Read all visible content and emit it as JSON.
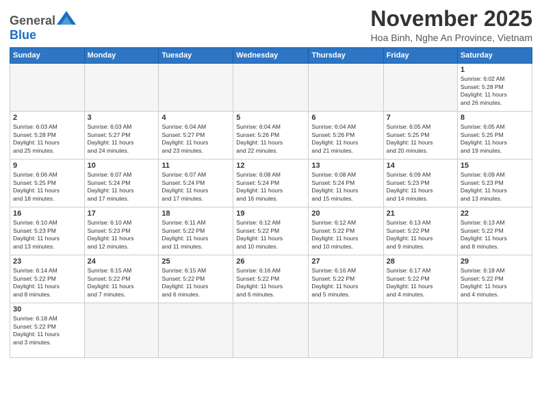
{
  "header": {
    "logo_general": "General",
    "logo_blue": "Blue",
    "month_title": "November 2025",
    "location": "Hoa Binh, Nghe An Province, Vietnam"
  },
  "weekdays": [
    "Sunday",
    "Monday",
    "Tuesday",
    "Wednesday",
    "Thursday",
    "Friday",
    "Saturday"
  ],
  "weeks": [
    {
      "days": [
        {
          "num": "",
          "info": "",
          "empty": true
        },
        {
          "num": "",
          "info": "",
          "empty": true
        },
        {
          "num": "",
          "info": "",
          "empty": true
        },
        {
          "num": "",
          "info": "",
          "empty": true
        },
        {
          "num": "",
          "info": "",
          "empty": true
        },
        {
          "num": "",
          "info": "",
          "empty": true
        },
        {
          "num": "1",
          "info": "Sunrise: 6:02 AM\nSunset: 5:28 PM\nDaylight: 11 hours\nand 26 minutes."
        }
      ]
    },
    {
      "days": [
        {
          "num": "2",
          "info": "Sunrise: 6:03 AM\nSunset: 5:28 PM\nDaylight: 11 hours\nand 25 minutes."
        },
        {
          "num": "3",
          "info": "Sunrise: 6:03 AM\nSunset: 5:27 PM\nDaylight: 11 hours\nand 24 minutes."
        },
        {
          "num": "4",
          "info": "Sunrise: 6:04 AM\nSunset: 5:27 PM\nDaylight: 11 hours\nand 23 minutes."
        },
        {
          "num": "5",
          "info": "Sunrise: 6:04 AM\nSunset: 5:26 PM\nDaylight: 11 hours\nand 22 minutes."
        },
        {
          "num": "6",
          "info": "Sunrise: 6:04 AM\nSunset: 5:26 PM\nDaylight: 11 hours\nand 21 minutes."
        },
        {
          "num": "7",
          "info": "Sunrise: 6:05 AM\nSunset: 5:25 PM\nDaylight: 11 hours\nand 20 minutes."
        },
        {
          "num": "8",
          "info": "Sunrise: 6:05 AM\nSunset: 5:25 PM\nDaylight: 11 hours\nand 19 minutes."
        }
      ]
    },
    {
      "days": [
        {
          "num": "9",
          "info": "Sunrise: 6:06 AM\nSunset: 5:25 PM\nDaylight: 11 hours\nand 18 minutes."
        },
        {
          "num": "10",
          "info": "Sunrise: 6:07 AM\nSunset: 5:24 PM\nDaylight: 11 hours\nand 17 minutes."
        },
        {
          "num": "11",
          "info": "Sunrise: 6:07 AM\nSunset: 5:24 PM\nDaylight: 11 hours\nand 17 minutes."
        },
        {
          "num": "12",
          "info": "Sunrise: 6:08 AM\nSunset: 5:24 PM\nDaylight: 11 hours\nand 16 minutes."
        },
        {
          "num": "13",
          "info": "Sunrise: 6:08 AM\nSunset: 5:24 PM\nDaylight: 11 hours\nand 15 minutes."
        },
        {
          "num": "14",
          "info": "Sunrise: 6:09 AM\nSunset: 5:23 PM\nDaylight: 11 hours\nand 14 minutes."
        },
        {
          "num": "15",
          "info": "Sunrise: 6:09 AM\nSunset: 5:23 PM\nDaylight: 11 hours\nand 13 minutes."
        }
      ]
    },
    {
      "days": [
        {
          "num": "16",
          "info": "Sunrise: 6:10 AM\nSunset: 5:23 PM\nDaylight: 11 hours\nand 13 minutes."
        },
        {
          "num": "17",
          "info": "Sunrise: 6:10 AM\nSunset: 5:23 PM\nDaylight: 11 hours\nand 12 minutes."
        },
        {
          "num": "18",
          "info": "Sunrise: 6:11 AM\nSunset: 5:22 PM\nDaylight: 11 hours\nand 11 minutes."
        },
        {
          "num": "19",
          "info": "Sunrise: 6:12 AM\nSunset: 5:22 PM\nDaylight: 11 hours\nand 10 minutes."
        },
        {
          "num": "20",
          "info": "Sunrise: 6:12 AM\nSunset: 5:22 PM\nDaylight: 11 hours\nand 10 minutes."
        },
        {
          "num": "21",
          "info": "Sunrise: 6:13 AM\nSunset: 5:22 PM\nDaylight: 11 hours\nand 9 minutes."
        },
        {
          "num": "22",
          "info": "Sunrise: 6:13 AM\nSunset: 5:22 PM\nDaylight: 11 hours\nand 8 minutes."
        }
      ]
    },
    {
      "days": [
        {
          "num": "23",
          "info": "Sunrise: 6:14 AM\nSunset: 5:22 PM\nDaylight: 11 hours\nand 8 minutes."
        },
        {
          "num": "24",
          "info": "Sunrise: 6:15 AM\nSunset: 5:22 PM\nDaylight: 11 hours\nand 7 minutes."
        },
        {
          "num": "25",
          "info": "Sunrise: 6:15 AM\nSunset: 5:22 PM\nDaylight: 11 hours\nand 6 minutes."
        },
        {
          "num": "26",
          "info": "Sunrise: 6:16 AM\nSunset: 5:22 PM\nDaylight: 11 hours\nand 6 minutes."
        },
        {
          "num": "27",
          "info": "Sunrise: 6:16 AM\nSunset: 5:22 PM\nDaylight: 11 hours\nand 5 minutes."
        },
        {
          "num": "28",
          "info": "Sunrise: 6:17 AM\nSunset: 5:22 PM\nDaylight: 11 hours\nand 4 minutes."
        },
        {
          "num": "29",
          "info": "Sunrise: 6:18 AM\nSunset: 5:22 PM\nDaylight: 11 hours\nand 4 minutes."
        }
      ]
    },
    {
      "days": [
        {
          "num": "30",
          "info": "Sunrise: 6:18 AM\nSunset: 5:22 PM\nDaylight: 11 hours\nand 3 minutes."
        },
        {
          "num": "",
          "info": "",
          "empty": true
        },
        {
          "num": "",
          "info": "",
          "empty": true
        },
        {
          "num": "",
          "info": "",
          "empty": true
        },
        {
          "num": "",
          "info": "",
          "empty": true
        },
        {
          "num": "",
          "info": "",
          "empty": true
        },
        {
          "num": "",
          "info": "",
          "empty": true
        }
      ]
    }
  ]
}
